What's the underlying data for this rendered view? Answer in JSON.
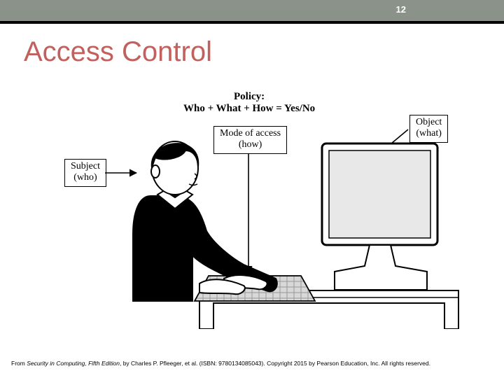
{
  "page_number": "12",
  "title": "Access Control",
  "policy": {
    "line1": "Policy:",
    "line2": "Who + What + How = Yes/No"
  },
  "callouts": {
    "subject": {
      "line1": "Subject",
      "line2": "(who)"
    },
    "mode": {
      "line1": "Mode of access",
      "line2": "(how)"
    },
    "object": {
      "line1": "Object",
      "line2": "(what)"
    }
  },
  "attribution": {
    "prefix": "From ",
    "book": "Security in Computing, Fifth Edition",
    "rest": ", by Charles P. Pfleeger, et al. (ISBN: 9780134085043). Copyright 2015 by Pearson Education, Inc. All rights reserved."
  }
}
